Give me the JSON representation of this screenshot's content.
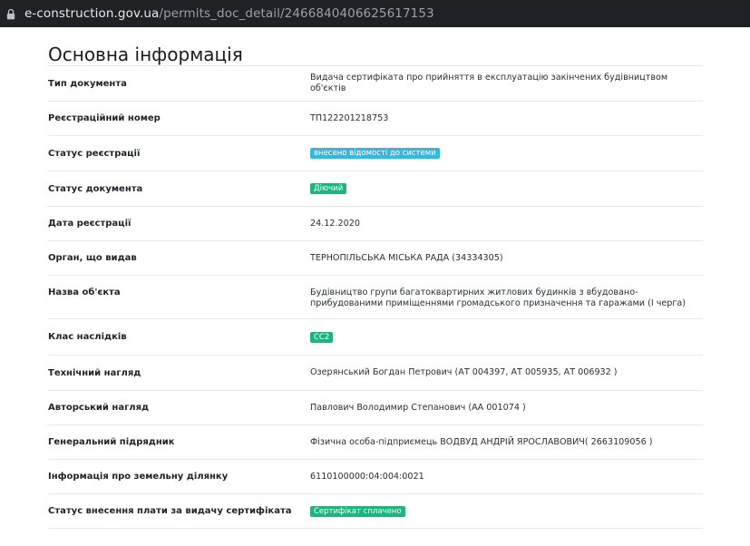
{
  "browser": {
    "url_host": "e-construction.gov.ua",
    "url_path": "/permits_doc_detail/2466840406625617153"
  },
  "page": {
    "title": "Основна інформація"
  },
  "colors": {
    "badge_info": "#37b7dd",
    "badge_success": "#1fb37e"
  },
  "rows": [
    {
      "label": "Тип документа",
      "value": "Видача сертифіката про прийняття в експлуатацію закінчених будівництвом об'єктів"
    },
    {
      "label": "Реєстраційний номер",
      "value": "ТП122201218753"
    },
    {
      "label": "Статус реєстрації",
      "value": "внесено відомості до системи"
    },
    {
      "label": "Статус документа",
      "value": "Діючий"
    },
    {
      "label": "Дата реєстрації",
      "value": "24.12.2020"
    },
    {
      "label": "Орган, що видав",
      "value": "ТЕРНОПІЛЬСЬКА МІСЬКА РАДА (34334305)"
    },
    {
      "label": "Назва об'єкта",
      "value": "Будівництво групи багатоквартирних житлових будинків з вбудовано-прибудованими приміщеннями громадського призначення та гаражами (І черга)"
    },
    {
      "label": "Клас наслідків",
      "value": "СС2"
    },
    {
      "label": "Технічний нагляд",
      "value": "Озерянський Богдан Петрович (АТ 004397, АТ 005935, АТ 006932 )"
    },
    {
      "label": "Авторський нагляд",
      "value": "Павлович Володимир Степанович (АА 001074 )"
    },
    {
      "label": "Генеральний підрядник",
      "value": "Фізична особа-підприємець ВОДВУД АНДРІЙ ЯРОСЛАВОВИЧ( 2663109056 )"
    },
    {
      "label": "Інформація про земельну ділянку",
      "value": "6110100000:04:004:0021"
    },
    {
      "label": "Статус внесення плати за видачу сертифіката",
      "value": "Сертифікат сплачено"
    }
  ]
}
